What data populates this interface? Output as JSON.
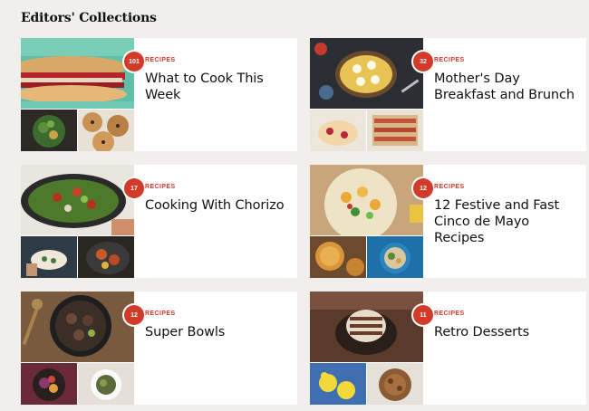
{
  "section": {
    "title": "Editors' Collections"
  },
  "collections": [
    {
      "count": "101",
      "kind": "RECIPES",
      "title": "What to Cook This Week"
    },
    {
      "count": "32",
      "kind": "RECIPES",
      "title": "Mother's Day Breakfast and Brunch"
    },
    {
      "count": "17",
      "kind": "RECIPES",
      "title": "Cooking With Chorizo"
    },
    {
      "count": "12",
      "kind": "RECIPES",
      "title": "12 Festive and Fast Cinco de Mayo Recipes"
    },
    {
      "count": "12",
      "kind": "RECIPES",
      "title": "Super Bowls"
    },
    {
      "count": "11",
      "kind": "RECIPES",
      "title": "Retro Desserts"
    }
  ]
}
